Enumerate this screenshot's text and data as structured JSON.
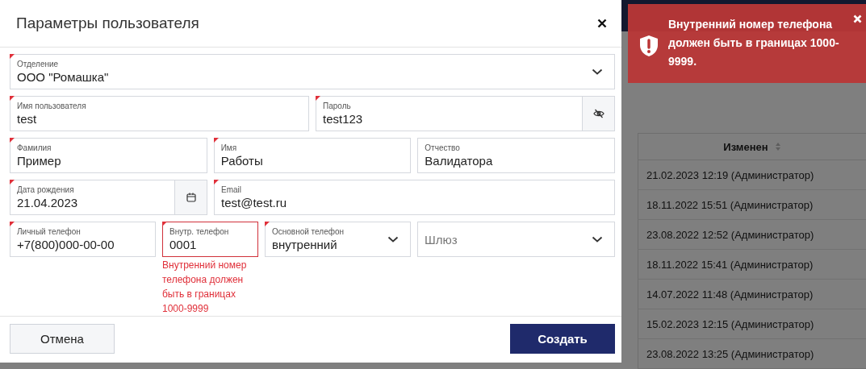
{
  "background": {
    "table": {
      "columns": [
        {
          "label": "Изменен"
        }
      ],
      "rows": [
        {
          "changed": "21.02.2023 12:19 (Администратор)"
        },
        {
          "changed": "18.11.2022 15:51 (Администратор)"
        },
        {
          "changed": "23.08.2022 12:52 (Администратор)"
        },
        {
          "changed": "18.11.2022 15:41 (Администратор)"
        },
        {
          "changed": "14.07.2022 11:48 (Администратор)"
        },
        {
          "changed": "15.02.2023 12:15 (Администратор)"
        },
        {
          "changed": "23.08.2022 13:25 (Администратор)"
        }
      ]
    }
  },
  "dialog": {
    "title": "Параметры пользователя",
    "form_lines": [
      {
        "fields": [
          {
            "kind": "select",
            "label": "Отделение",
            "value": "ООО \"Ромашка\"",
            "required": true
          }
        ]
      },
      {
        "fields": [
          {
            "kind": "text",
            "label": "Имя пользователя",
            "value": "test",
            "required": true
          },
          {
            "kind": "password",
            "label": "Пароль",
            "value": "test123",
            "required": true
          }
        ]
      },
      {
        "fields": [
          {
            "kind": "text",
            "label": "Фамилия",
            "value": "Пример",
            "required": true
          },
          {
            "kind": "text",
            "label": "Имя",
            "value": "Работы",
            "required": true
          },
          {
            "kind": "text",
            "label": "Отчество",
            "value": "Валидатора",
            "required": false
          }
        ]
      },
      {
        "fields": [
          {
            "kind": "date",
            "label": "Дата рождения",
            "value": "21.04.2023",
            "required": true
          },
          {
            "kind": "text",
            "label": "Email",
            "value": "test@test.ru",
            "required": true
          }
        ]
      },
      {
        "fields": [
          {
            "kind": "text",
            "label": "Личный телефон",
            "value": "+7(800)000-00-00",
            "required": true
          },
          {
            "kind": "text",
            "label": "Внутр. телефон",
            "value": "0001",
            "required": true,
            "error": "Внутренний номер телефона должен быть в границах 1000-9999"
          },
          {
            "kind": "select",
            "label": "Основной телефон",
            "value": "внутренний",
            "required": true
          },
          {
            "kind": "select",
            "placeholder": "Шлюз",
            "required": false
          }
        ]
      }
    ],
    "cancel_button": "Отмена",
    "submit_button": "Создать"
  },
  "toast": {
    "message": "Внутренний номер телефона должен быть в границах 1000-9999."
  }
}
